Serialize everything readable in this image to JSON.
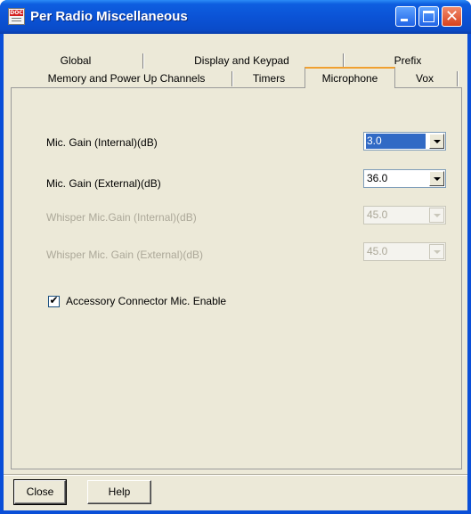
{
  "window": {
    "title": "Per Radio Miscellaneous",
    "icon": "doc-app-icon",
    "icon_tag": "DOC"
  },
  "tabs": {
    "row1": [
      "Global",
      "Display and Keypad",
      "Prefix"
    ],
    "row2": [
      "Memory and Power Up Channels",
      "Timers",
      "Microphone",
      "Vox"
    ],
    "active": "Microphone"
  },
  "fields": [
    {
      "label": "Mic. Gain (Internal)(dB)",
      "value": "3.0",
      "enabled": true,
      "selected": true
    },
    {
      "label": "Mic. Gain (External)(dB)",
      "value": "36.0",
      "enabled": true,
      "selected": false
    },
    {
      "label": "Whisper Mic.Gain (Internal)(dB)",
      "value": "45.0",
      "enabled": false,
      "selected": false
    },
    {
      "label": "Whisper Mic. Gain (External)(dB)",
      "value": "45.0",
      "enabled": false,
      "selected": false
    }
  ],
  "checkbox": {
    "label": "Accessory Connector Mic. Enable",
    "checked": true,
    "mark": "✔"
  },
  "buttons": {
    "close": "Close",
    "help": "Help"
  },
  "titlebar_buttons": {
    "close_glyph": "✕"
  }
}
